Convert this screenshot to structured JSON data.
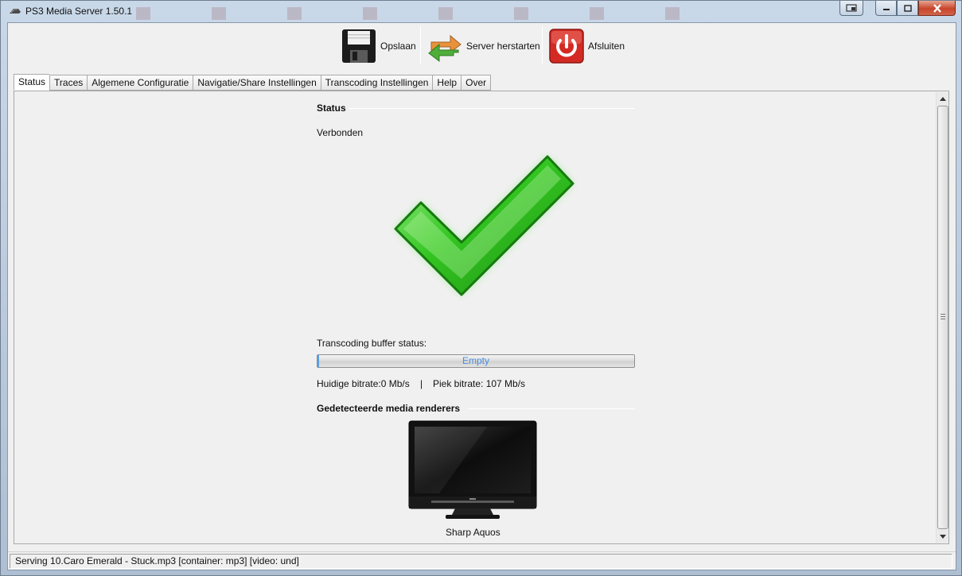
{
  "window": {
    "title": "PS3 Media Server 1.50.1"
  },
  "toolbar": {
    "save_label": "Opslaan",
    "restart_label": "Server herstarten",
    "shutdown_label": "Afsluiten"
  },
  "tabs": [
    {
      "label": "Status",
      "active": true
    },
    {
      "label": "Traces",
      "active": false
    },
    {
      "label": "Algemene Configuratie",
      "active": false
    },
    {
      "label": "Navigatie/Share Instellingen",
      "active": false
    },
    {
      "label": "Transcoding Instellingen",
      "active": false
    },
    {
      "label": "Help",
      "active": false
    },
    {
      "label": "Over",
      "active": false
    }
  ],
  "status": {
    "section_title": "Status",
    "connection_text": "Verbonden",
    "buffer_label": "Transcoding buffer status:",
    "buffer_text": "Empty",
    "buffer_fraction": 0.005,
    "current_bitrate": "Huidige bitrate:0 Mb/s",
    "separator": "|",
    "peak_bitrate": "Piek bitrate: 107 Mb/s",
    "renderers_title": "Gedetecteerde media renderers",
    "renderer_name": "Sharp Aquos"
  },
  "statusbar": {
    "text": "Serving 10.Caro Emerald - Stuck.mp3 [container: mp3] [video: und]"
  },
  "colors": {
    "check_green": "#2fbf1f",
    "progress_text": "#4a8fe0",
    "shutdown_red": "#d42a24"
  }
}
